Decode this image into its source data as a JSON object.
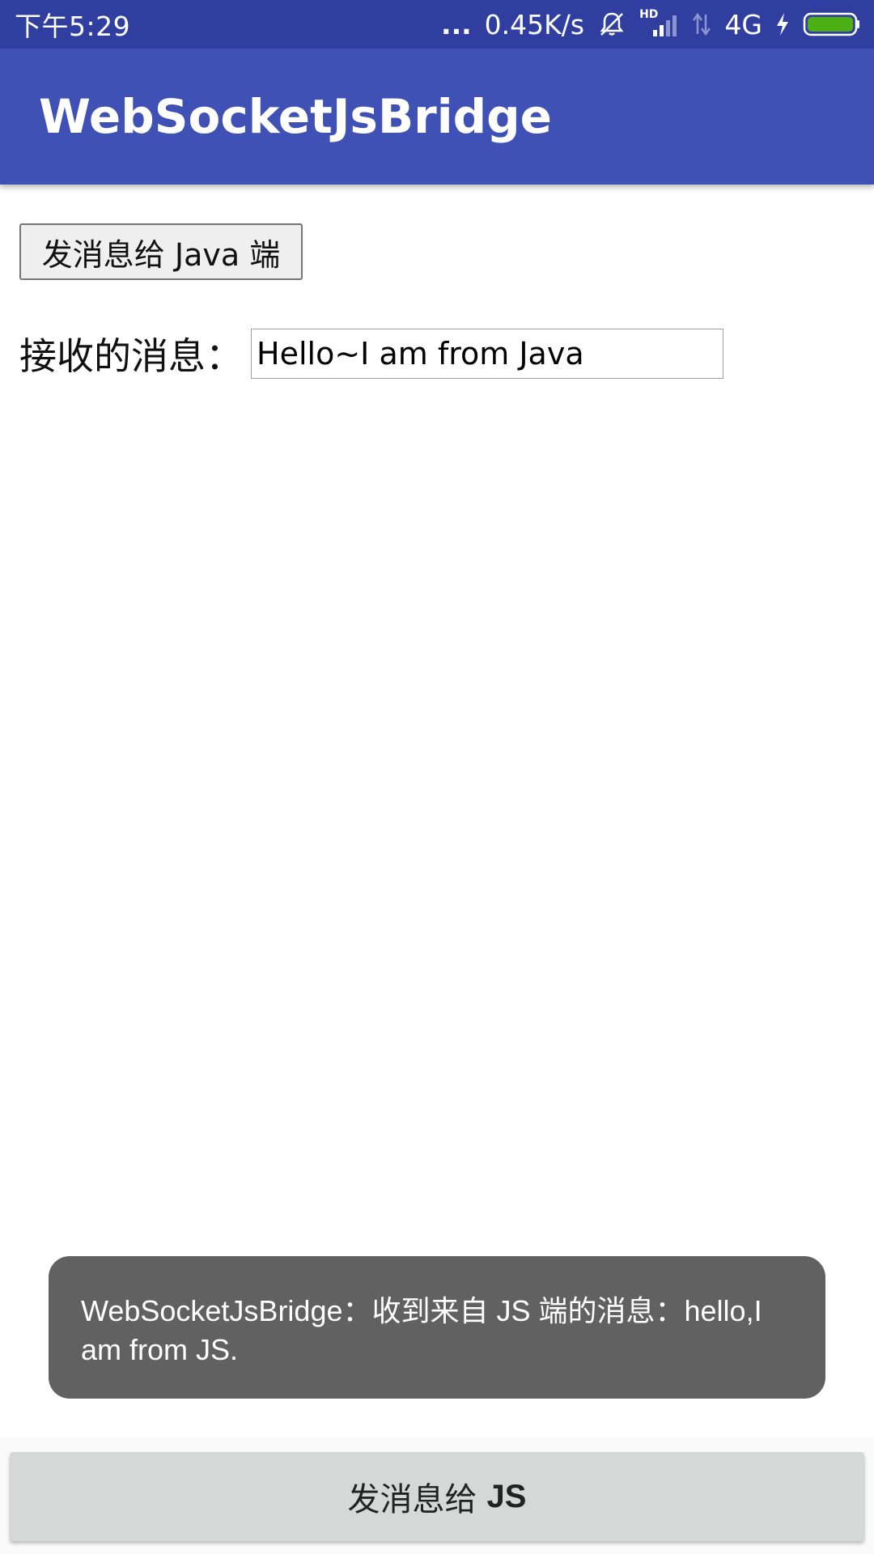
{
  "status_bar": {
    "time": "下午5:29",
    "dots": "...",
    "net_speed": "0.45K/s",
    "hd": "HD",
    "network_type": "4G",
    "icons": [
      "mute-icon",
      "signal-icon",
      "data-arrows-icon",
      "charging-icon",
      "battery-icon"
    ],
    "battery_color": "#4caf13"
  },
  "app_bar": {
    "title": "WebSocketJsBridge",
    "color": "#3f51b5"
  },
  "web": {
    "send_java_label": "发消息给 Java 端",
    "received_label": "接收的消息：",
    "received_value": "Hello~I am from Java"
  },
  "toast": {
    "message": "WebSocketJsBridge：收到来自 JS 端的消息：hello,I am from JS."
  },
  "bottom": {
    "button_prefix": "发消息给",
    "button_bold": "JS"
  }
}
